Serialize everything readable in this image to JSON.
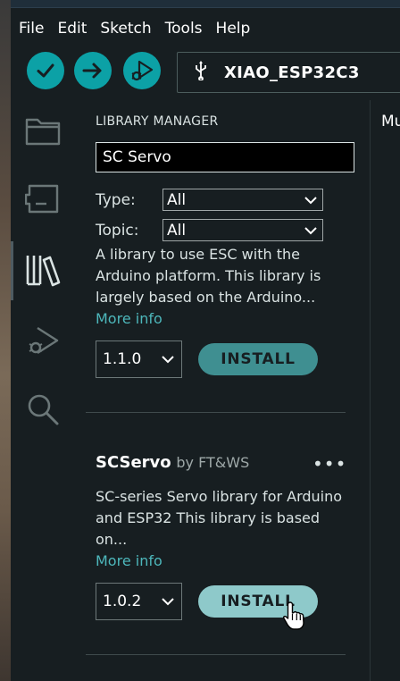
{
  "menu": [
    "File",
    "Edit",
    "Sketch",
    "Tools",
    "Help"
  ],
  "toolbar": {
    "board_name": "XIAO_ESP32C3"
  },
  "sidebar": [
    "folder-icon",
    "board-icon",
    "library-icon",
    "debug-icon",
    "search-icon"
  ],
  "library_manager": {
    "title": "LIBRARY MANAGER",
    "search_value": "SC Servo",
    "type_label": "Type:",
    "type_value": "All",
    "topic_label": "Topic:",
    "topic_value": "All"
  },
  "libraries": [
    {
      "description": "A library to use ESC with the Arduino platform. This library is largely based on the Arduino...",
      "more_info": "More info",
      "version": "1.1.0",
      "install_label": "INSTALL"
    },
    {
      "name": "SCServo",
      "by": "by FT&WS",
      "description": "SC-series Servo library for Arduino and ESP32 This library is based on...",
      "more_info": "More info",
      "version": "1.0.2",
      "install_label": "INSTALL"
    }
  ],
  "right_pane": {
    "text": "Mu"
  },
  "colors": {
    "accent": "#0ca1a6",
    "link": "#4db7bb",
    "install_button": "#3f8f91",
    "install_button_hover": "#8ec9ca"
  }
}
